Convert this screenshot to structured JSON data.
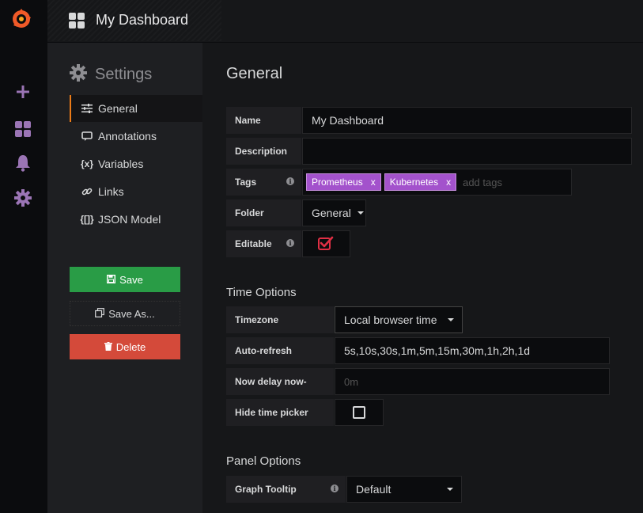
{
  "topnav": {
    "title": "My Dashboard"
  },
  "sidebar": {
    "title": "Settings",
    "items": [
      {
        "label": "General",
        "icon": "sliders-icon",
        "active": true
      },
      {
        "label": "Annotations",
        "icon": "comment-icon"
      },
      {
        "label": "Variables",
        "icon": "variable-icon",
        "icon_text": "{x}"
      },
      {
        "label": "Links",
        "icon": "link-icon"
      },
      {
        "label": "JSON Model",
        "icon": "json-icon",
        "icon_text": "{[]}"
      }
    ],
    "save_label": "Save",
    "save_as_label": "Save As...",
    "delete_label": "Delete"
  },
  "general": {
    "heading": "General",
    "name_label": "Name",
    "name_value": "My Dashboard",
    "description_label": "Description",
    "description_value": "",
    "tags_label": "Tags",
    "tags": [
      "Prometheus",
      "Kubernetes"
    ],
    "tag_remove": "x",
    "tags_placeholder": "add tags",
    "folder_label": "Folder",
    "folder_value": "General",
    "editable_label": "Editable",
    "editable_checked": true
  },
  "time_options": {
    "heading": "Time Options",
    "timezone_label": "Timezone",
    "timezone_value": "Local browser time",
    "autorefresh_label": "Auto-refresh",
    "autorefresh_value": "5s,10s,30s,1m,5m,15m,30m,1h,2h,1d",
    "nowdelay_label": "Now delay now-",
    "nowdelay_placeholder": "0m",
    "hidepicker_label": "Hide time picker",
    "hidepicker_checked": false
  },
  "panel_options": {
    "heading": "Panel Options",
    "tooltip_label": "Graph Tooltip",
    "tooltip_value": "Default"
  },
  "colors": {
    "accent": "#eb7b18",
    "save": "#299c46",
    "delete": "#d44a3a",
    "tag": "#a352cc",
    "check": "#e02f44",
    "sidemenu_icon": "#9b75b5"
  }
}
